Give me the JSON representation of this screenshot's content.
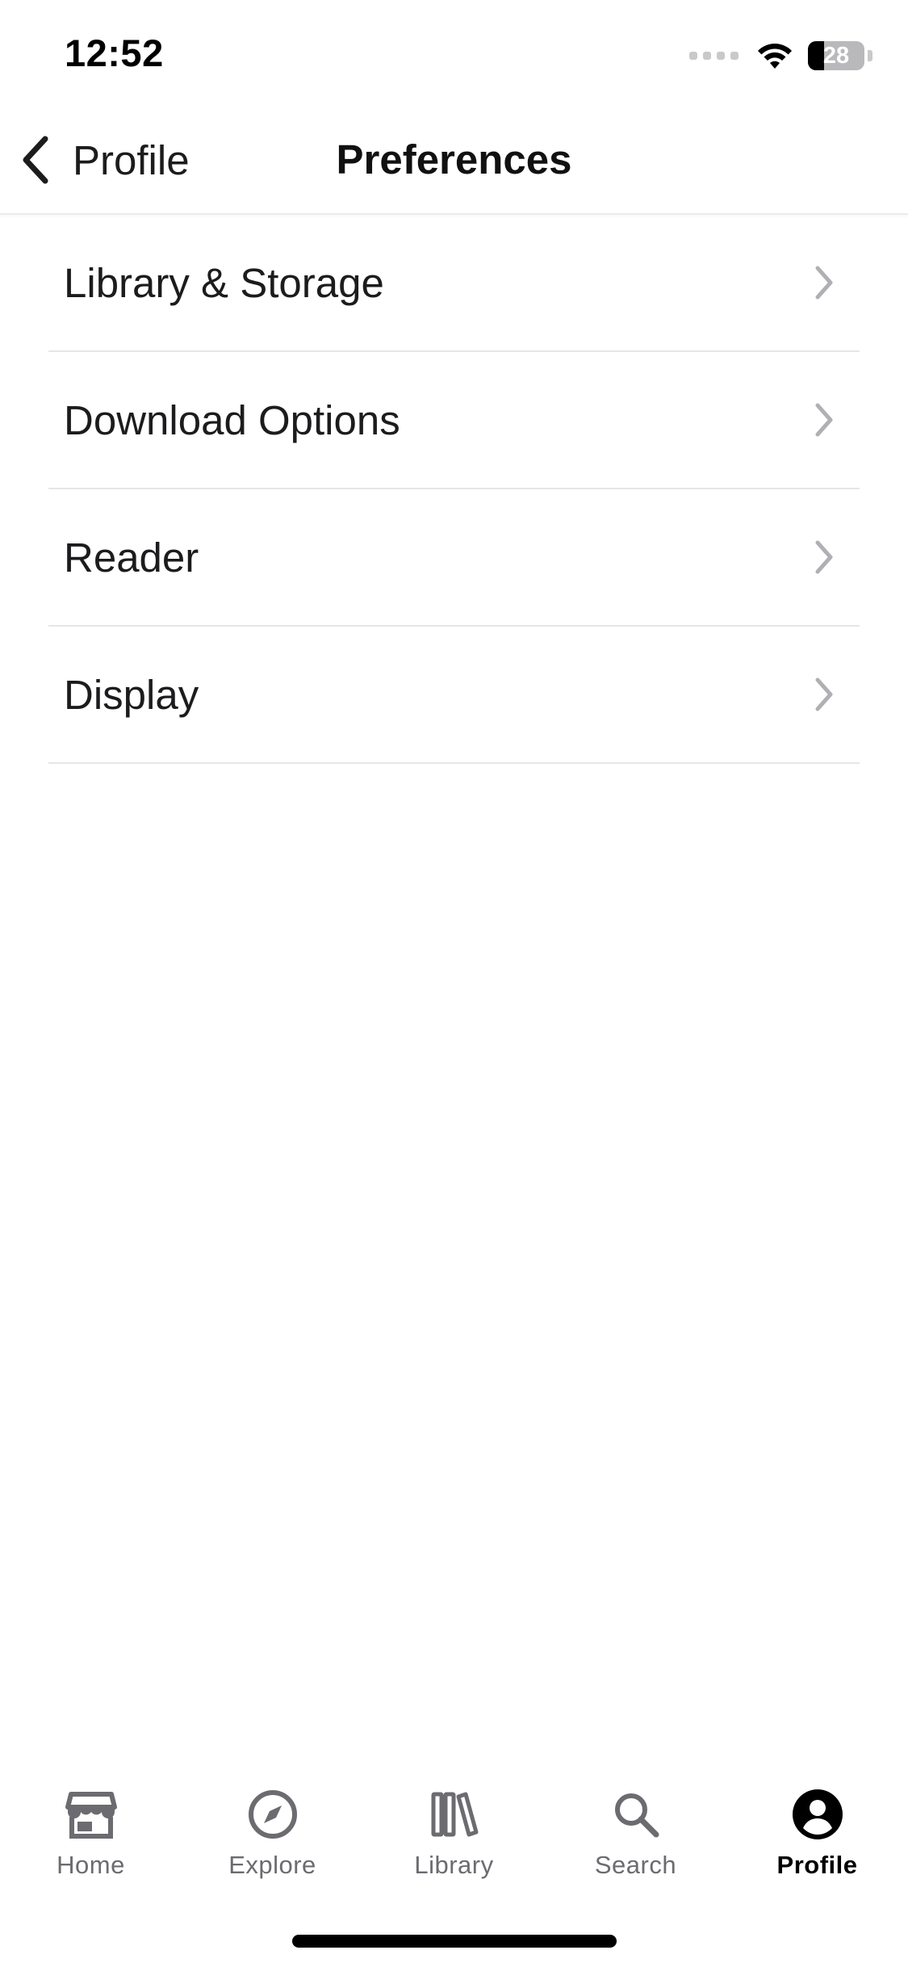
{
  "status_bar": {
    "time": "12:52",
    "battery_percent": "28",
    "battery_level": 0.28
  },
  "nav": {
    "back_label": "Profile",
    "title": "Preferences"
  },
  "settings": {
    "items": [
      {
        "label": "Library & Storage"
      },
      {
        "label": "Download Options"
      },
      {
        "label": "Reader"
      },
      {
        "label": "Display"
      }
    ]
  },
  "tab_bar": {
    "active": "Profile",
    "tabs": [
      {
        "label": "Home",
        "icon": "store-icon"
      },
      {
        "label": "Explore",
        "icon": "compass-icon"
      },
      {
        "label": "Library",
        "icon": "books-icon"
      },
      {
        "label": "Search",
        "icon": "search-icon"
      },
      {
        "label": "Profile",
        "icon": "account-circle-icon"
      }
    ]
  },
  "colors": {
    "text_primary": "#1c1c1e",
    "tab_inactive": "#6b6b70",
    "tab_active": "#000000",
    "divider": "#e6e6e8",
    "chevron": "#b0b0b4"
  }
}
